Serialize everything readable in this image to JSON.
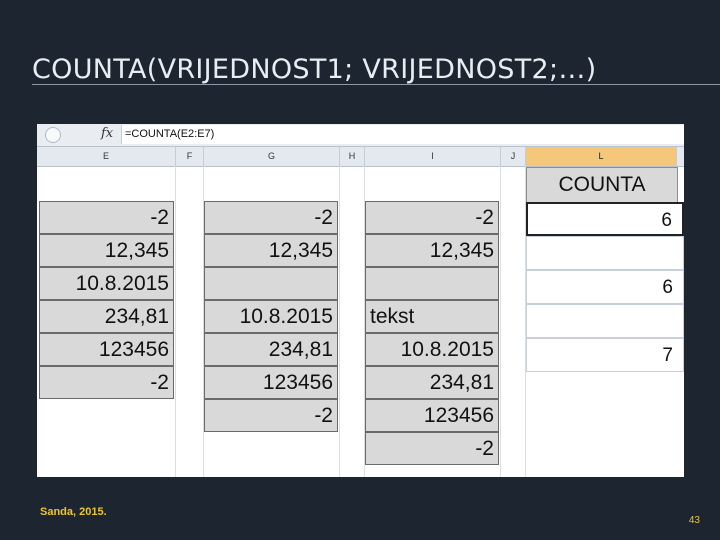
{
  "slide": {
    "title": "COUNTA(VRIJEDNOST1; VRIJEDNOST2;…)",
    "footer": "Sanda, 2015.",
    "page_number": "43"
  },
  "spreadsheet": {
    "formula": "=COUNTA(E2:E7)",
    "column_headers": [
      "E",
      "F",
      "G",
      "H",
      "I",
      "J",
      "L"
    ],
    "selected_column": "L",
    "col_E": [
      "-2",
      "12,345",
      "10.8.2015",
      "234,81",
      "123456",
      "-2"
    ],
    "col_G": [
      "-2",
      "12,345",
      "",
      "10.8.2015",
      "234,81",
      "123456",
      "-2"
    ],
    "col_I": [
      "-2",
      "12,345",
      "",
      "tekst",
      "10.8.2015",
      "234,81",
      "123456",
      "-2"
    ],
    "col_L_header": "COUNTA",
    "col_L": [
      "6",
      "",
      "6",
      "",
      "7"
    ]
  }
}
